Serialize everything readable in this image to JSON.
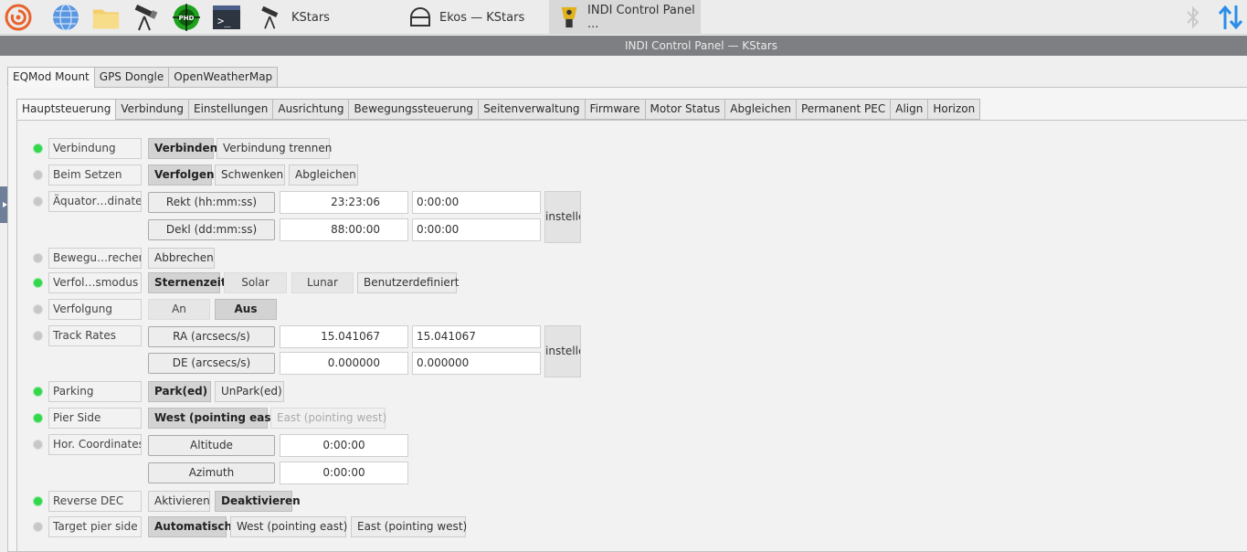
{
  "taskbar": {
    "tasks": [
      "KStars",
      "Ekos — KStars",
      "INDI Control Panel ..."
    ]
  },
  "window": {
    "title": "INDI Control Panel — KStars"
  },
  "device_tabs": [
    "EQMod Mount",
    "GPS Dongle",
    "OpenWeatherMap"
  ],
  "group_tabs": [
    "Hauptsteuerung",
    "Verbindung",
    "Einstellungen",
    "Ausrichtung",
    "Bewegungssteuerung",
    "Seitenverwaltung",
    "Firmware",
    "Motor Status",
    "Abgleichen",
    "Permanent PEC",
    "Align",
    "Horizon"
  ],
  "props": {
    "connection": {
      "label": "Verbindung",
      "connect": "Verbinden",
      "disconnect": "Verbindung trennen"
    },
    "on_set": {
      "label": "Beim Setzen",
      "track": "Verfolgen",
      "slew": "Schwenken",
      "sync": "Abgleichen"
    },
    "eq_coords": {
      "label": "Äquator…dinaten",
      "ra_label": "Rekt (hh:mm:ss)",
      "ra_value": "23:23:06",
      "ra_input": "0:00:00",
      "dec_label": "Dekl (dd:mm:ss)",
      "dec_value": "88:00:00",
      "dec_input": "0:00:00",
      "set": "instelle"
    },
    "abort": {
      "label": "Bewegu…rechen",
      "abort": "Abbrechen"
    },
    "track_mode": {
      "label": "Verfol…smodus",
      "sidereal": "Sternenzeit",
      "solar": "Solar",
      "lunar": "Lunar",
      "custom": "Benutzerdefiniert"
    },
    "tracking": {
      "label": "Verfolgung",
      "on": "An",
      "off": "Aus"
    },
    "track_rates": {
      "label": "Track Rates",
      "ra_label": "RA (arcsecs/s)",
      "ra_value": "15.041067",
      "ra_input": "15.041067",
      "de_label": "DE (arcsecs/s)",
      "de_value": "0.000000",
      "de_input": "0.000000",
      "set": "instelle"
    },
    "parking": {
      "label": "Parking",
      "park": "Park(ed)",
      "unpark": "UnPark(ed)"
    },
    "pier_side": {
      "label": "Pier Side",
      "west": "West (pointing east)",
      "east": "East (pointing west)"
    },
    "hor_coords": {
      "label": "Hor. Coordinates",
      "alt_label": "Altitude",
      "alt_value": "0:00:00",
      "az_label": "Azimuth",
      "az_value": "0:00:00"
    },
    "reverse_dec": {
      "label": "Reverse DEC",
      "enable": "Aktivieren",
      "disable": "Deaktivieren"
    },
    "target_pier": {
      "label": "Target pier side",
      "auto": "Automatisch",
      "west": "West (pointing east)",
      "east": "East (pointing west)"
    }
  },
  "colors": {
    "led_ok": "#32d74b",
    "led_idle": "#c7c7c7",
    "titlebar": "#7d7f82",
    "accent_blue": "#2a8ee8"
  }
}
